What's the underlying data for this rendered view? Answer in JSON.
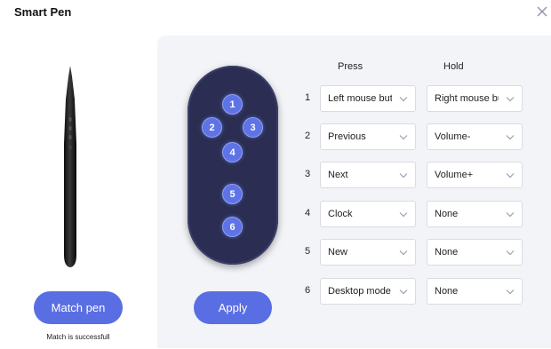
{
  "window": {
    "title": "Smart Pen",
    "close_icon": "close-icon"
  },
  "left": {
    "pen_image": "smart-pen",
    "match_button": "Match pen",
    "match_status": "Match is successfull"
  },
  "remote": {
    "buttons": [
      "1",
      "2",
      "3",
      "4",
      "5",
      "6"
    ]
  },
  "apply_button": "Apply",
  "table": {
    "headers": {
      "press": "Press",
      "hold": "Hold"
    },
    "rows": [
      {
        "num": "1",
        "press": "Left mouse button",
        "hold": "Right mouse button"
      },
      {
        "num": "2",
        "press": "Previous",
        "hold": "Volume-"
      },
      {
        "num": "3",
        "press": "Next",
        "hold": "Volume+"
      },
      {
        "num": "4",
        "press": "Clock",
        "hold": "None"
      },
      {
        "num": "5",
        "press": "New",
        "hold": "None"
      },
      {
        "num": "6",
        "press": "Desktop mode",
        "hold": "None"
      }
    ]
  },
  "colors": {
    "accent": "#5a6ee3",
    "remote_body": "#2b2e52",
    "panel_bg": "#f3f4f8"
  }
}
